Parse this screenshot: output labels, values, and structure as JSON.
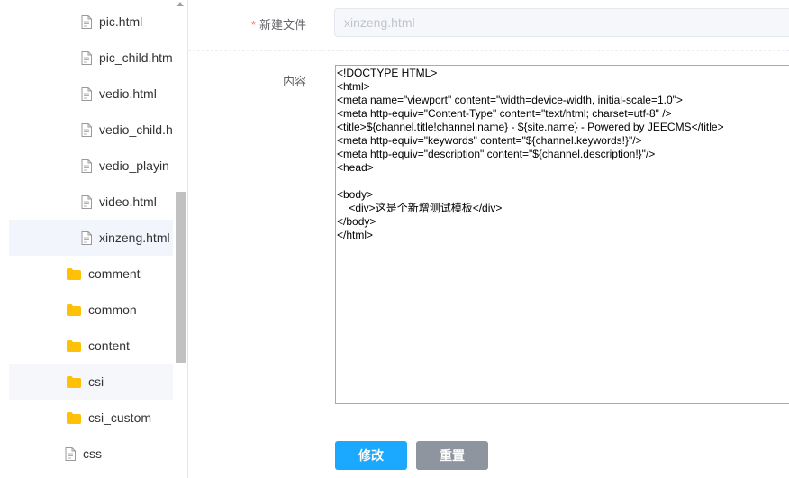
{
  "tree": {
    "items": [
      {
        "label": "pic.html",
        "type": "file"
      },
      {
        "label": "pic_child.htm",
        "type": "file"
      },
      {
        "label": "vedio.html",
        "type": "file"
      },
      {
        "label": "vedio_child.h",
        "type": "file"
      },
      {
        "label": "vedio_playin",
        "type": "file"
      },
      {
        "label": "video.html",
        "type": "file"
      },
      {
        "label": "xinzeng.html",
        "type": "file",
        "selected": true
      },
      {
        "label": "comment",
        "type": "folder"
      },
      {
        "label": "common",
        "type": "folder"
      },
      {
        "label": "content",
        "type": "folder"
      },
      {
        "label": "csi",
        "type": "folder",
        "hovered": true
      },
      {
        "label": "csi_custom",
        "type": "folder"
      },
      {
        "label": "css",
        "type": "file"
      }
    ]
  },
  "form": {
    "required_mark": "*",
    "filename_label": "新建文件",
    "filename_value": "xinzeng.html",
    "content_label": "内容",
    "content_value": "<!DOCTYPE HTML>\n<html>\n<meta name=\"viewport\" content=\"width=device-width, initial-scale=1.0\">\n<meta http-equiv=\"Content-Type\" content=\"text/html; charset=utf-8\" />\n<title>${channel.title!channel.name} - ${site.name} - Powered by JEECMS</title>\n<meta http-equiv=\"keywords\" content=\"${channel.keywords!}\"/>\n<meta http-equiv=\"description\" content=\"${channel.description!}\"/>\n<head>\n\n<body>\n    <div>这是个新增测试模板</div>\n</body>\n</html>",
    "save_label": "修改",
    "reset_label": "重置"
  },
  "colors": {
    "primary": "#1aa9ff",
    "secondary": "#8e959e",
    "folder": "#ffc107",
    "required": "#f56c6c"
  }
}
